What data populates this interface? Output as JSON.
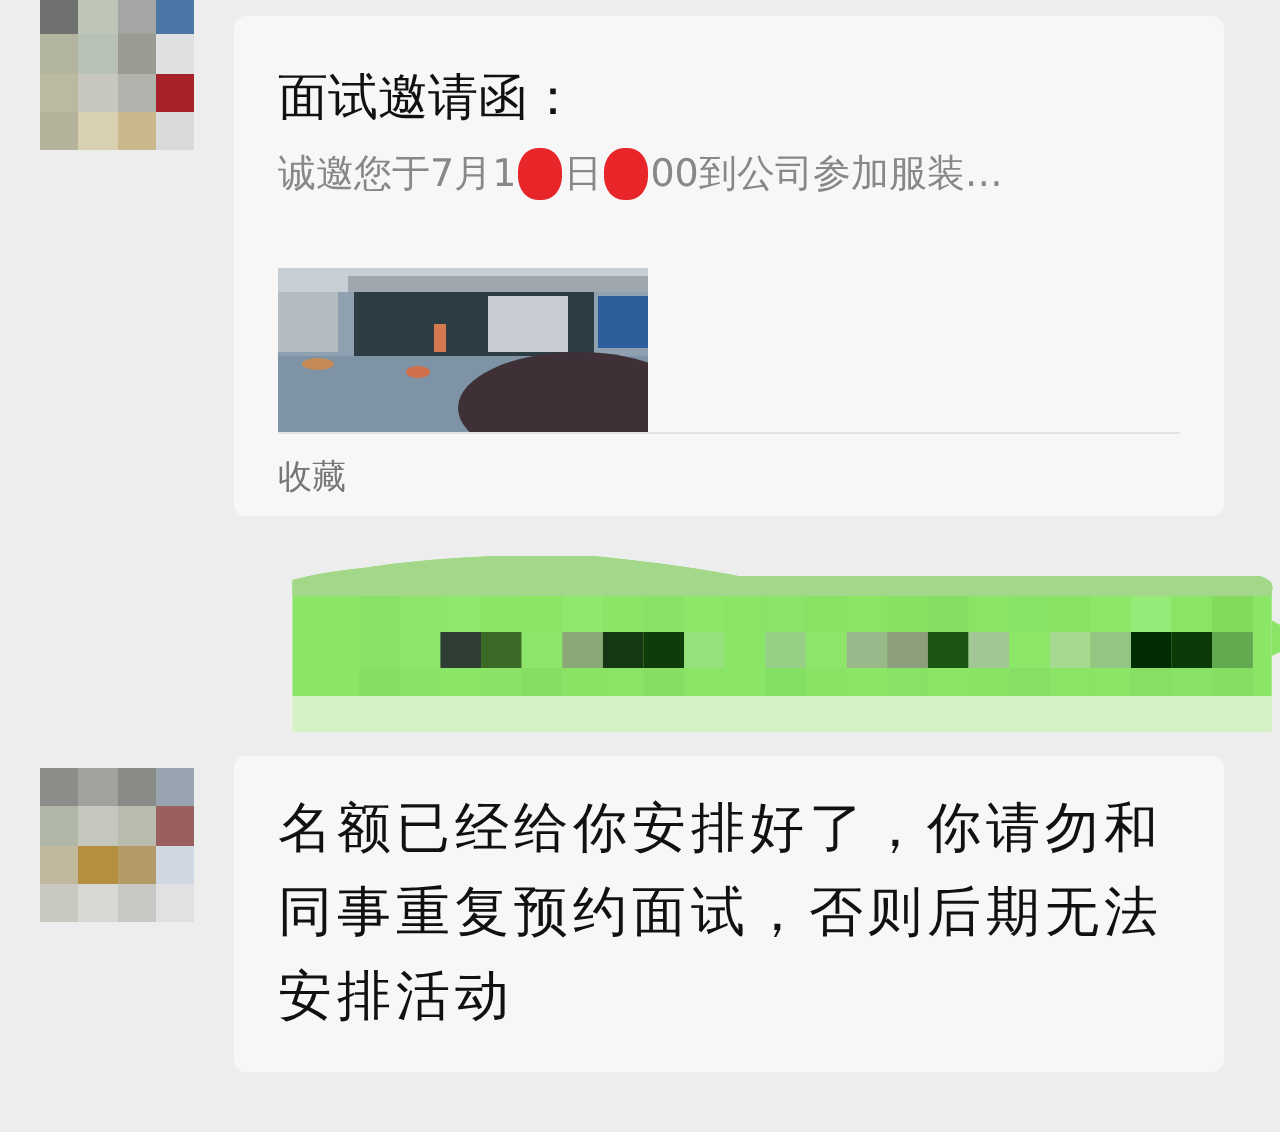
{
  "messages": [
    {
      "kind": "card",
      "outgoing": false,
      "title": "面试邀请函：",
      "preview": [
        "诚邀您于7月1",
        "日",
        "00到公司参加服装…"
      ],
      "source": "收藏"
    },
    {
      "kind": "pixelated",
      "outgoing": true
    },
    {
      "kind": "text",
      "outgoing": false,
      "text": "名额已经给你安排好了，你请勿和同事重复预约面试，否则后期无法安排活动"
    }
  ]
}
